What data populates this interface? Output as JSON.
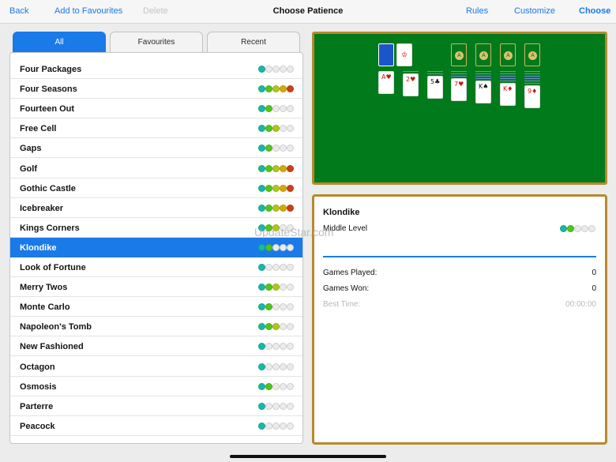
{
  "toolbar": {
    "back": "Back",
    "add_favourites": "Add to Favourites",
    "delete": "Delete",
    "title": "Choose Patience",
    "rules": "Rules",
    "customize": "Customize",
    "choose": "Choose"
  },
  "tabs": [
    {
      "label": "All",
      "active": true
    },
    {
      "label": "Favourites",
      "active": false
    },
    {
      "label": "Recent",
      "active": false
    }
  ],
  "colors": {
    "accent": "#1a7ae8",
    "felt": "#007a1a",
    "border_gold": "#b8892e",
    "difficulty": [
      "#17b8a6",
      "#53c41b",
      "#b2c41d",
      "#d7a800",
      "#c6431a"
    ],
    "empty_dot": "#ebebeb"
  },
  "games": [
    {
      "name": "Four Packages",
      "difficulty": 1
    },
    {
      "name": "Four Seasons",
      "difficulty": 5
    },
    {
      "name": "Fourteen Out",
      "difficulty": 2
    },
    {
      "name": "Free Cell",
      "difficulty": 3
    },
    {
      "name": "Gaps",
      "difficulty": 2
    },
    {
      "name": "Golf",
      "difficulty": 5
    },
    {
      "name": "Gothic Castle",
      "difficulty": 5
    },
    {
      "name": "Icebreaker",
      "difficulty": 5
    },
    {
      "name": "Kings Corners",
      "difficulty": 3
    },
    {
      "name": "Klondike",
      "difficulty": 2,
      "selected": true
    },
    {
      "name": "Look of Fortune",
      "difficulty": 1
    },
    {
      "name": "Merry Twos",
      "difficulty": 3
    },
    {
      "name": "Monte Carlo",
      "difficulty": 2
    },
    {
      "name": "Napoleon's Tomb",
      "difficulty": 3
    },
    {
      "name": "New Fashioned",
      "difficulty": 1
    },
    {
      "name": "Octagon",
      "difficulty": 1
    },
    {
      "name": "Osmosis",
      "difficulty": 2
    },
    {
      "name": "Parterre",
      "difficulty": 1
    },
    {
      "name": "Peacock",
      "difficulty": 1
    }
  ],
  "preview": {
    "foundation_label": "A",
    "tableau": [
      "A♥",
      "2♥",
      "5♣",
      "7♥",
      "K♠",
      "K♦",
      "9♦"
    ]
  },
  "details": {
    "title": "Klondike",
    "level": "Middle Level",
    "difficulty": 2,
    "games_played_label": "Games Played:",
    "games_played": "0",
    "games_won_label": "Games Won:",
    "games_won": "0",
    "best_time_label": "Best Time:",
    "best_time": "00:00:00"
  },
  "watermark": "UpdateStar.com"
}
